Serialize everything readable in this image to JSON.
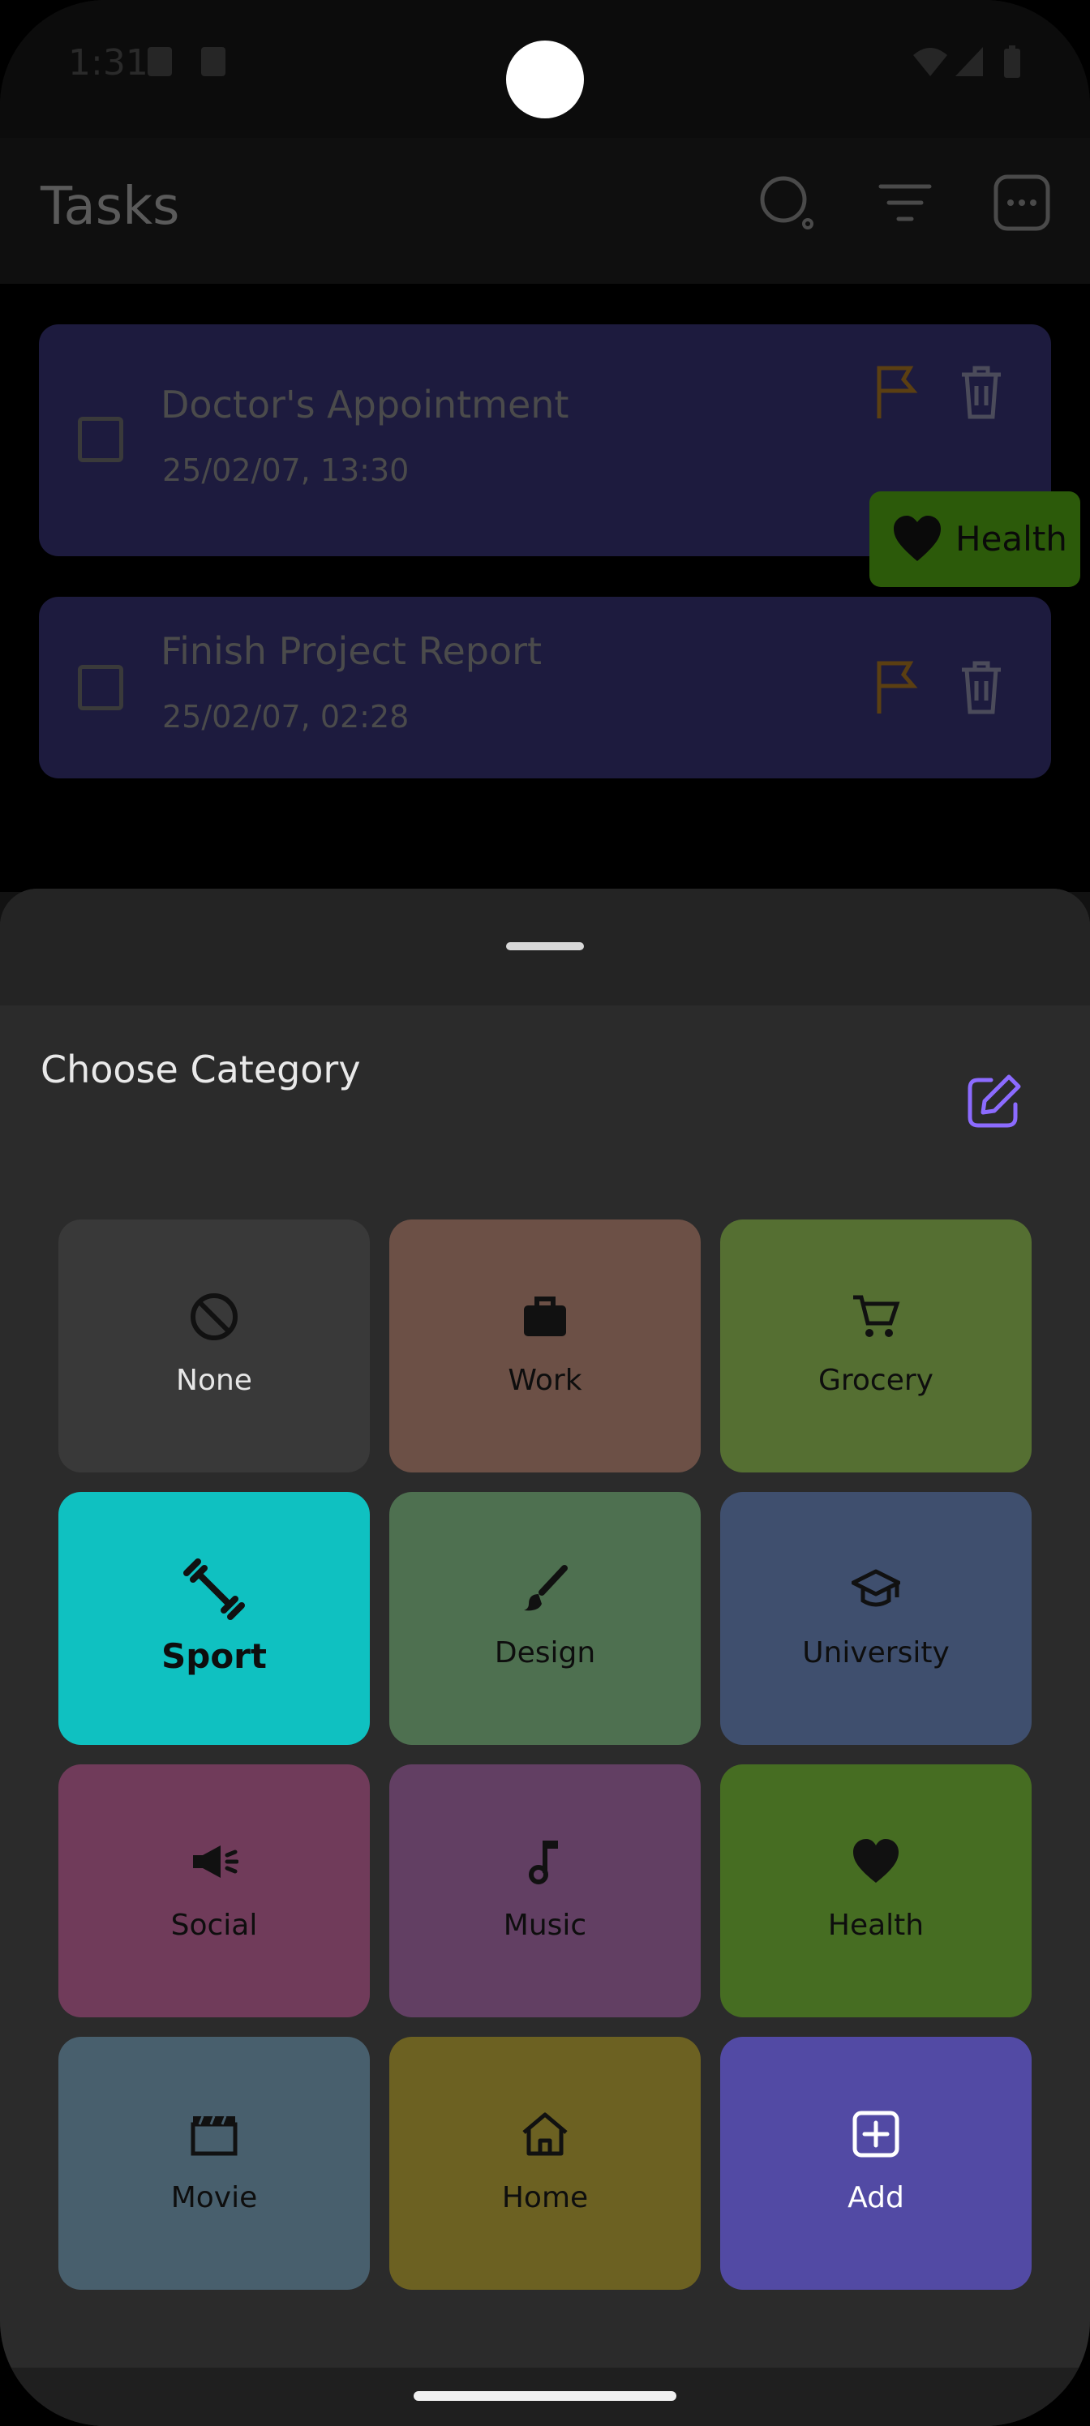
{
  "status": {
    "time": "1:31"
  },
  "appbar": {
    "title": "Tasks",
    "icons": [
      "search-icon",
      "filter-icon",
      "more-icon"
    ]
  },
  "tasks": [
    {
      "title": "Doctor's Appointment",
      "date": "25/02/07, 13:30",
      "category": "Health"
    },
    {
      "title": "Finish Project Report",
      "date": "25/02/07, 02:28"
    }
  ],
  "sheet": {
    "title": "Choose Category",
    "edit_icon": "edit-icon",
    "categories": [
      {
        "label": "None",
        "icon": "block-icon",
        "color": "#393939"
      },
      {
        "label": "Work",
        "icon": "briefcase-icon",
        "color": "#6c5046"
      },
      {
        "label": "Grocery",
        "icon": "cart-icon",
        "color": "#556f32"
      },
      {
        "label": "Sport",
        "icon": "dumbbell-icon",
        "color": "#0fc1c1",
        "selected": true
      },
      {
        "label": "Design",
        "icon": "brush-icon",
        "color": "#4e7050"
      },
      {
        "label": "University",
        "icon": "graduation-cap-icon",
        "color": "#3f4f6e"
      },
      {
        "label": "Social",
        "icon": "megaphone-icon",
        "color": "#703b5a"
      },
      {
        "label": "Music",
        "icon": "music-note-icon",
        "color": "#623f63"
      },
      {
        "label": "Health",
        "icon": "heart-icon",
        "color": "#466d22"
      },
      {
        "label": "Movie",
        "icon": "clapperboard-icon",
        "color": "#485f6d"
      },
      {
        "label": "Home",
        "icon": "home-icon",
        "color": "#6c6122"
      },
      {
        "label": "Add",
        "icon": "add-box-icon",
        "color": "#524aa4"
      }
    ]
  },
  "colors": {
    "accent": "#8c6bff",
    "task_bg": "#1d1b3e",
    "sheet_bg": "#2b2b2b"
  }
}
